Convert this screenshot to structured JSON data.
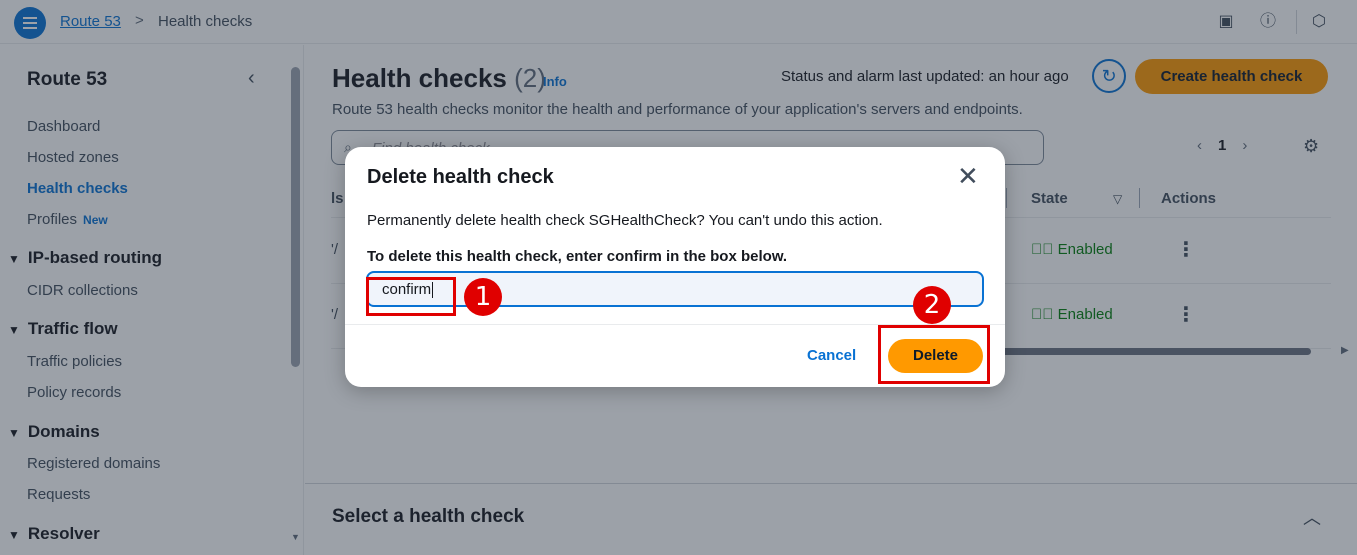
{
  "topbar": {
    "breadcrumb_root": "Route 53",
    "breadcrumb_sep": ">",
    "breadcrumb_current": "Health checks",
    "icons": [
      "menu-icon",
      "panel-icon",
      "info-icon",
      "settings-badge-icon"
    ]
  },
  "sidebar": {
    "title": "Route 53",
    "items": [
      {
        "label": "Dashboard"
      },
      {
        "label": "Hosted zones"
      },
      {
        "label": "Health checks",
        "active": true
      },
      {
        "label": "Profiles",
        "badge": "New"
      }
    ],
    "sections": [
      {
        "label": "IP-based routing",
        "items": [
          "CIDR collections"
        ]
      },
      {
        "label": "Traffic flow",
        "items": [
          "Traffic policies",
          "Policy records"
        ]
      },
      {
        "label": "Domains",
        "items": [
          "Registered domains",
          "Requests"
        ]
      },
      {
        "label": "Resolver",
        "items": []
      }
    ]
  },
  "main": {
    "title": "Health checks",
    "count": "(2)",
    "info": "Info",
    "status": "Status and alarm last updated: an hour ago",
    "create_button": "Create health check",
    "description": "Route 53 health checks monitor the health and performance of your application's servers and endpoints.",
    "search_placeholder": "Find health check",
    "page_number": "1",
    "columns": [
      "State",
      "Actions"
    ],
    "partial_column": "ls",
    "rows": [
      {
        "partial": "'/",
        "state": "Enabled"
      },
      {
        "partial": "'/",
        "state": "Enabled"
      }
    ],
    "bottom_panel_title": "Select a health check"
  },
  "modal": {
    "title": "Delete health check",
    "body": "Permanently delete health check SGHealthCheck? You can't undo this action.",
    "instruction_prefix": "To delete this health check, enter ",
    "instruction_keyword": "confirm",
    "instruction_suffix": " in the box below.",
    "input_value": "confirm",
    "cancel_label": "Cancel",
    "delete_label": "Delete"
  },
  "annotations": {
    "step1": "1",
    "step2": "2",
    "color": "#e00000"
  },
  "colors": {
    "accent": "#0972d3",
    "primary_button": "#ff9900",
    "success": "#037f0c"
  }
}
